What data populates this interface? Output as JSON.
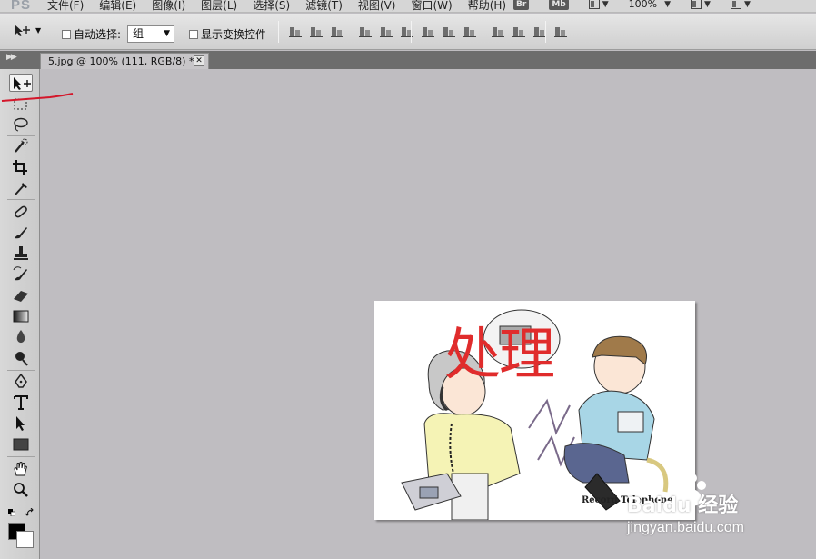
{
  "app": {
    "logo": "PS"
  },
  "menu": [
    "文件(F)",
    "编辑(E)",
    "图像(I)",
    "图层(L)",
    "选择(S)",
    "滤镜(T)",
    "视图(V)",
    "窗口(W)",
    "帮助(H)"
  ],
  "menu_right": {
    "bridge_badge": "Br",
    "mini_bridge_badge": "Mb",
    "zoom": "100%"
  },
  "options": {
    "auto_select_label": "自动选择:",
    "auto_select_value": "组",
    "show_transform_label": "显示变换控件"
  },
  "document": {
    "tab_title": "5.jpg @ 100% (111, RGB/8) *",
    "close_glyph": "✕"
  },
  "canvas": {
    "overlay_text": "处理",
    "image_caption": "Record Telephone"
  },
  "watermark": {
    "brand": "Baidu 经验",
    "url": "jingyan.baidu.com"
  },
  "colors": {
    "foreground": "#000000",
    "background": "#ffffff",
    "annotation": "#d4162a",
    "overlay_text": "#e02c2c"
  },
  "toolbox": [
    {
      "name": "move-tool-icon"
    },
    {
      "name": "marquee-tool-icon"
    },
    {
      "name": "lasso-tool-icon"
    },
    {
      "name": "quick-select-tool-icon"
    },
    {
      "name": "crop-tool-icon"
    },
    {
      "name": "eyedropper-tool-icon"
    },
    {
      "name": "healing-brush-tool-icon"
    },
    {
      "name": "brush-tool-icon"
    },
    {
      "name": "clone-stamp-tool-icon"
    },
    {
      "name": "history-brush-tool-icon"
    },
    {
      "name": "eraser-tool-icon"
    },
    {
      "name": "gradient-tool-icon"
    },
    {
      "name": "blur-tool-icon"
    },
    {
      "name": "dodge-tool-icon"
    },
    {
      "name": "pen-tool-icon"
    },
    {
      "name": "type-tool-icon"
    },
    {
      "name": "path-select-tool-icon"
    },
    {
      "name": "shape-tool-icon"
    },
    {
      "name": "hand-tool-icon"
    },
    {
      "name": "zoom-tool-icon"
    }
  ]
}
